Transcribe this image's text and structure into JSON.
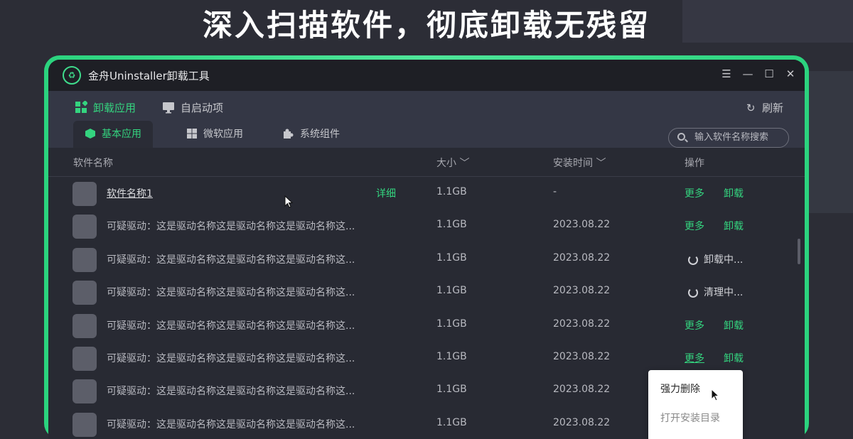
{
  "headline": "深入扫描软件，彻底卸载无残留",
  "window": {
    "title": "金舟Uninstaller卸载工具",
    "controls": {
      "menu": "☰",
      "minimize": "—",
      "maximize": "☐",
      "close": "✕"
    }
  },
  "topnav": [
    {
      "label": "卸载应用",
      "icon": "apps-icon",
      "active": true
    },
    {
      "label": "自启动项",
      "icon": "monitor-icon",
      "active": false
    }
  ],
  "refresh_label": "刷新",
  "tabs": [
    {
      "label": "基本应用",
      "icon": "cube-icon",
      "active": true
    },
    {
      "label": "微软应用",
      "icon": "windows-icon",
      "active": false
    },
    {
      "label": "系统组件",
      "icon": "puzzle-icon",
      "active": false
    }
  ],
  "search": {
    "placeholder": "输入软件名称搜索"
  },
  "table": {
    "headers": {
      "name": "软件名称",
      "size": "大小",
      "date": "安装时间",
      "action": "操作"
    },
    "detail_label": "详细",
    "more_label": "更多",
    "uninstall_label": "卸载",
    "rows": [
      {
        "name": "软件名称1",
        "size": "1.1GB",
        "date": "-",
        "status": ""
      },
      {
        "name": "可疑驱动：这是驱动名称这是驱动名称这是驱动名称这...",
        "size": "1.1GB",
        "date": "2023.08.22",
        "status": ""
      },
      {
        "name": "可疑驱动：这是驱动名称这是驱动名称这是驱动名称这...",
        "size": "1.1GB",
        "date": "2023.08.22",
        "status": "卸载中..."
      },
      {
        "name": "可疑驱动：这是驱动名称这是驱动名称这是驱动名称这...",
        "size": "1.1GB",
        "date": "2023.08.22",
        "status": "清理中..."
      },
      {
        "name": "可疑驱动：这是驱动名称这是驱动名称这是驱动名称这...",
        "size": "1.1GB",
        "date": "2023.08.22",
        "status": ""
      },
      {
        "name": "可疑驱动：这是驱动名称这是驱动名称这是驱动名称这...",
        "size": "1.1GB",
        "date": "2023.08.22",
        "status": ""
      },
      {
        "name": "可疑驱动：这是驱动名称这是驱动名称这是驱动名称这...",
        "size": "1.1GB",
        "date": "2023.08.22",
        "status": ""
      },
      {
        "name": "可疑驱动：这是驱动名称这是驱动名称这是驱动名称这...",
        "size": "1.1GB",
        "date": "2023.08.22",
        "status": ""
      }
    ]
  },
  "popup": {
    "items": [
      "强力删除",
      "打开安装目录"
    ]
  },
  "colors": {
    "accent": "#34d47f",
    "background": "#282a33",
    "titlebar": "#1e1f25"
  }
}
